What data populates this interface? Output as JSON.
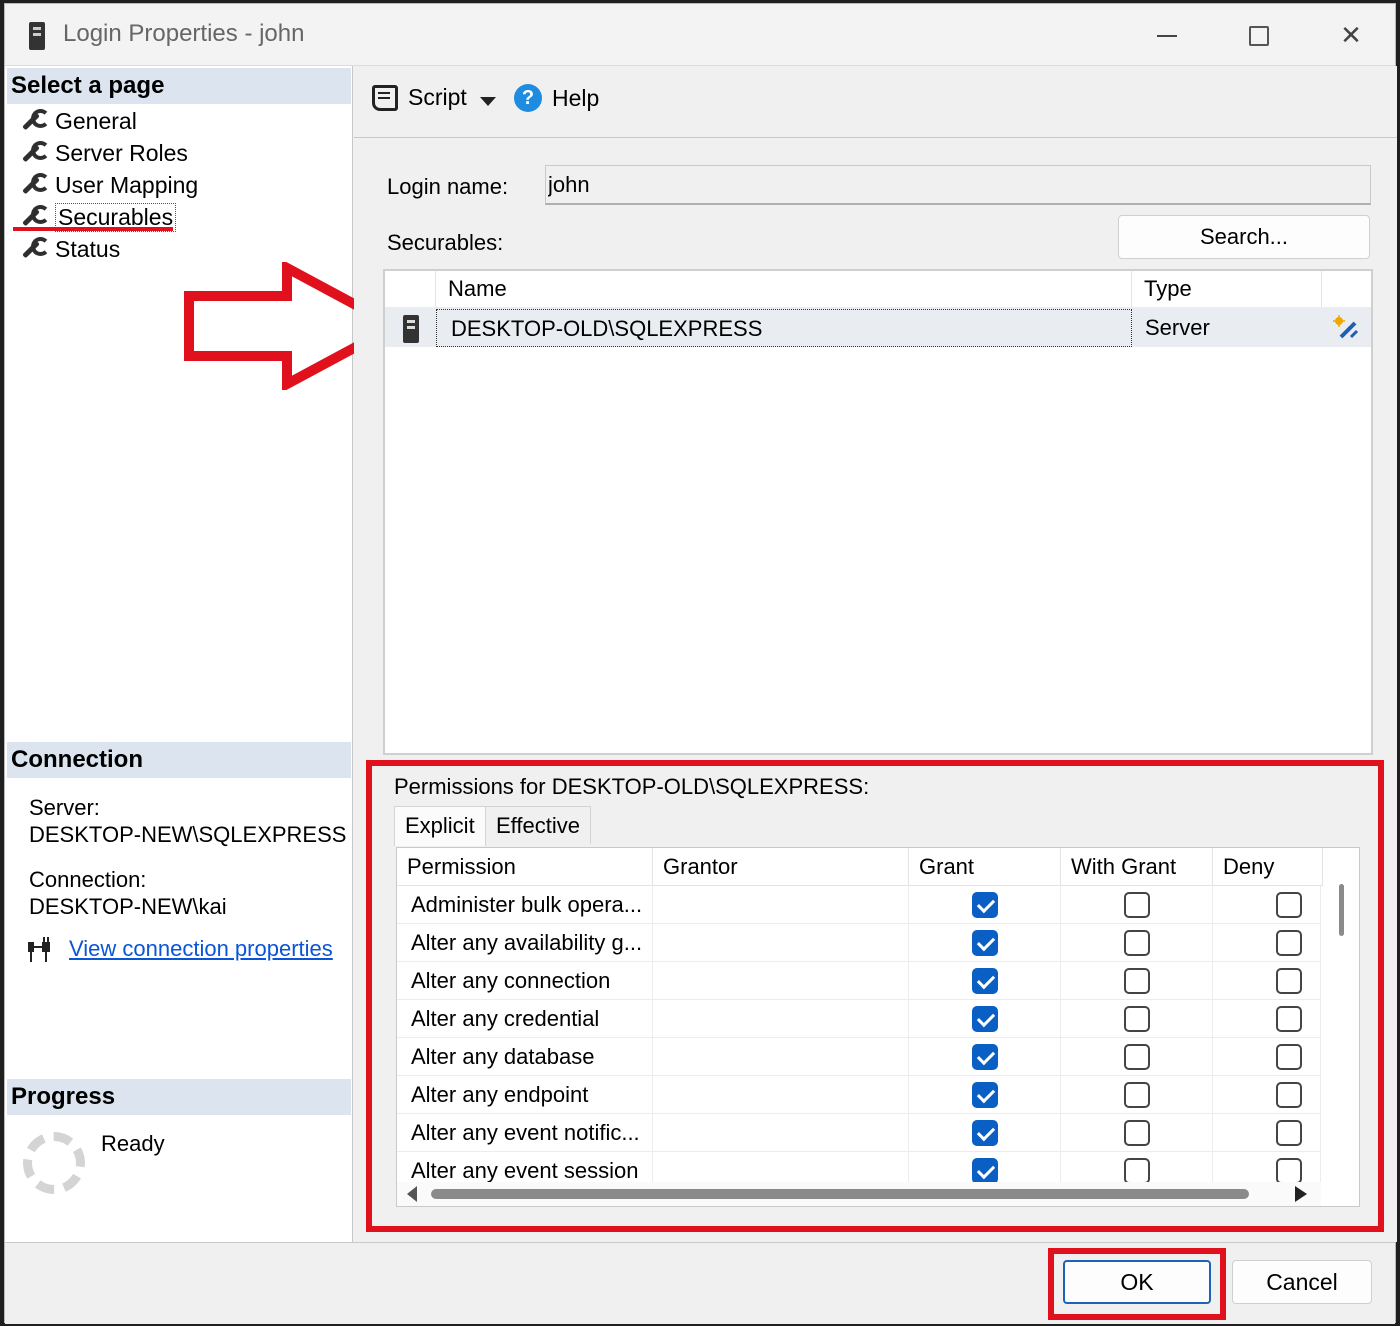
{
  "window": {
    "title": "Login Properties - john",
    "controls": {
      "minimize": "minimize",
      "maximize": "maximize",
      "close": "✕"
    }
  },
  "left_pane": {
    "select_page_header": "Select a page",
    "pages": [
      {
        "label": "General",
        "icon": "wrench-icon"
      },
      {
        "label": "Server Roles",
        "icon": "wrench-icon"
      },
      {
        "label": "User Mapping",
        "icon": "wrench-icon"
      },
      {
        "label": "Securables",
        "icon": "wrench-icon",
        "selected": true
      },
      {
        "label": "Status",
        "icon": "wrench-icon"
      }
    ],
    "connection": {
      "header": "Connection",
      "server_label": "Server:",
      "server_value": "DESKTOP-NEW\\SQLEXPRESS",
      "connection_label": "Connection:",
      "connection_value": "DESKTOP-NEW\\kai",
      "view_link": "View connection properties"
    },
    "progress": {
      "header": "Progress",
      "status": "Ready"
    }
  },
  "toolbar": {
    "script_label": "Script",
    "help_label": "Help"
  },
  "form": {
    "login_name_label": "Login name:",
    "login_name_value": "john",
    "securables_label": "Securables:",
    "search_button": "Search..."
  },
  "securables": {
    "columns": [
      "Name",
      "Type"
    ],
    "rows": [
      {
        "name": "DESKTOP-OLD\\SQLEXPRESS",
        "type": "Server"
      }
    ]
  },
  "permissions": {
    "title": "Permissions for DESKTOP-OLD\\SQLEXPRESS:",
    "tabs": [
      "Explicit",
      "Effective"
    ],
    "active_tab": "Explicit",
    "columns": [
      "Permission",
      "Grantor",
      "Grant",
      "With Grant",
      "Deny"
    ],
    "rows": [
      {
        "permission": "Administer bulk opera...",
        "grantor": "",
        "grant": true,
        "with_grant": false,
        "deny": false
      },
      {
        "permission": "Alter any availability g...",
        "grantor": "",
        "grant": true,
        "with_grant": false,
        "deny": false
      },
      {
        "permission": "Alter any connection",
        "grantor": "",
        "grant": true,
        "with_grant": false,
        "deny": false
      },
      {
        "permission": "Alter any credential",
        "grantor": "",
        "grant": true,
        "with_grant": false,
        "deny": false
      },
      {
        "permission": "Alter any database",
        "grantor": "",
        "grant": true,
        "with_grant": false,
        "deny": false
      },
      {
        "permission": "Alter any endpoint",
        "grantor": "",
        "grant": true,
        "with_grant": false,
        "deny": false
      },
      {
        "permission": "Alter any event notific...",
        "grantor": "",
        "grant": true,
        "with_grant": false,
        "deny": false
      },
      {
        "permission": "Alter any event session",
        "grantor": "",
        "grant": true,
        "with_grant": false,
        "deny": false
      }
    ]
  },
  "buttons": {
    "ok": "OK",
    "cancel": "Cancel"
  },
  "colors": {
    "annotation_red": "#e0101c",
    "checkbox_blue": "#0a5fc4",
    "link_blue": "#0a55d6",
    "section_header_bg": "#dbe4ef"
  }
}
